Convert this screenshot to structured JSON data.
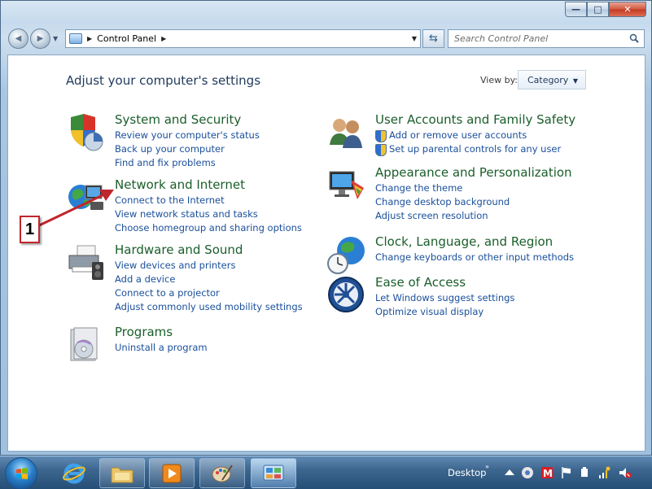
{
  "window": {
    "caption_min": "—",
    "caption_max": "□",
    "caption_close": "✕"
  },
  "nav": {
    "back_glyph": "◀",
    "forward_glyph": "▶",
    "address_text": "Control Panel",
    "address_separator": "▶",
    "search_placeholder": "Search Control Panel",
    "refresh_glyph": "⇆"
  },
  "page": {
    "title": "Adjust your computer's settings",
    "view_by_label": "View by:",
    "view_by_value": "Category"
  },
  "categories": [
    {
      "title": "System and Security",
      "icon": "shield-pie-icon",
      "links": [
        "Review your computer's status",
        "Back up your computer",
        "Find and fix problems"
      ]
    },
    {
      "title": "Network and Internet",
      "icon": "network-globe-icon",
      "links": [
        "Connect to the Internet",
        "View network status and tasks",
        "Choose homegroup and sharing options"
      ]
    },
    {
      "title": "Hardware and Sound",
      "icon": "printer-speaker-icon",
      "links": [
        "View devices and printers",
        "Add a device",
        "Connect to a projector",
        "Adjust commonly used mobility settings"
      ]
    },
    {
      "title": "Programs",
      "icon": "programs-disc-icon",
      "links": [
        "Uninstall a program"
      ]
    },
    {
      "title": "User Accounts and Family Safety",
      "icon": "users-icon",
      "links": [
        "Add or remove user accounts",
        "Set up parental controls for any user"
      ]
    },
    {
      "title": "Appearance and Personalization",
      "icon": "monitor-palette-icon",
      "links": [
        "Change the theme",
        "Change desktop background",
        "Adjust screen resolution"
      ]
    },
    {
      "title": "Clock, Language, and Region",
      "icon": "clock-globe-icon",
      "links": [
        "Change keyboards or other input methods"
      ]
    },
    {
      "title": "Ease of Access",
      "icon": "ease-of-access-icon",
      "links": [
        "Let Windows suggest settings",
        "Optimize visual display"
      ]
    }
  ],
  "annotation": {
    "label": "1",
    "color": "#c0262d"
  },
  "taskbar": {
    "desktop_label": "Desktop",
    "chevron": "»",
    "pinned": [
      "internet-explorer-icon",
      "explorer-folder-icon",
      "media-player-icon",
      "paint-icon",
      "control-panel-icon"
    ]
  },
  "colors": {
    "category_title": "#1a5e2a",
    "link": "#1a4f9b",
    "heading": "#1e395b"
  }
}
